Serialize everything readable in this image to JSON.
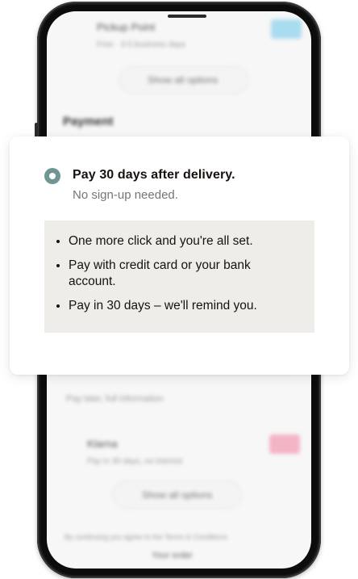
{
  "option": {
    "title": "Pay 30 days after delivery.",
    "subtitle": "No sign-up needed.",
    "selected": true
  },
  "benefits": [
    "One more click and you're all set.",
    "Pay with credit card or your bank account.",
    "Pay in 30 days – we'll remind you."
  ],
  "colors": {
    "radio": "#6f9595",
    "info_box": "#eeedea",
    "text": "#17120f"
  },
  "background_screen": {
    "delivery_option": "Pickup Point",
    "delivery_detail": "Free · 3-5 business days",
    "show_all_1": "Show all options",
    "section_heading": "Payment",
    "field_hint": "Pay later, full information",
    "alt_option": "Klarna",
    "alt_detail": "Pay in 30 days, no interest",
    "show_all_2": "Show all options",
    "terms": "By continuing you agree to the Terms & Conditions",
    "footer": "Your order"
  }
}
